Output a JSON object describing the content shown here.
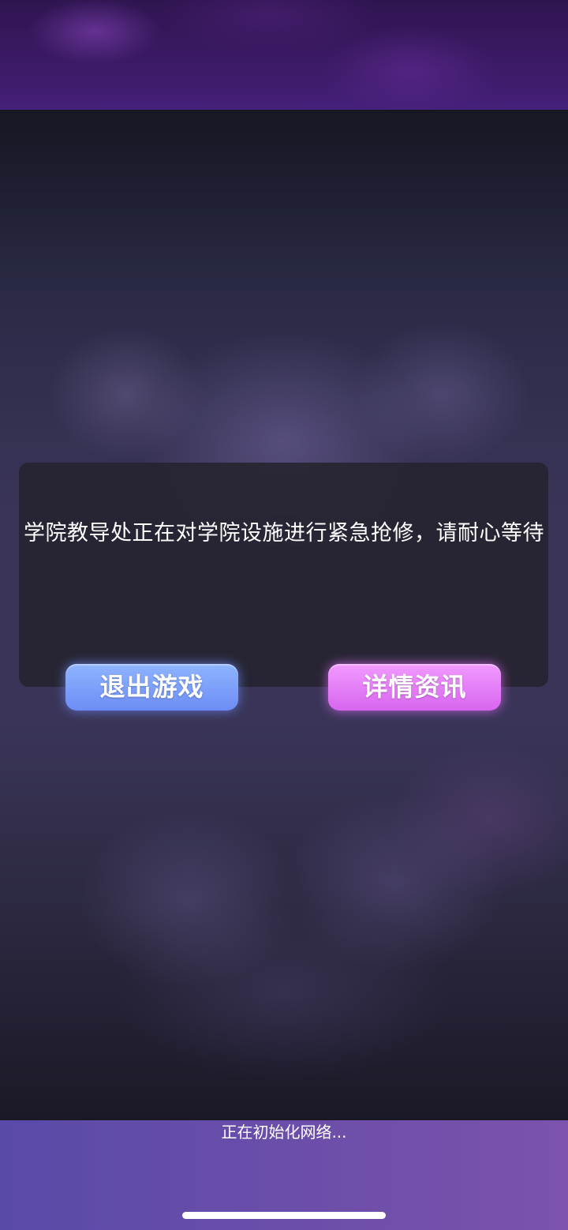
{
  "dialog": {
    "message": "学院教导处正在对学院设施进行紧急抢修，请耐心等待",
    "buttons": {
      "exit_label": "退出游戏",
      "details_label": "详情资讯"
    }
  },
  "status": {
    "loading_text": "正在初始化网络..."
  },
  "colors": {
    "exit_button": "#7a9cf9",
    "details_button": "#e27ff6",
    "bottom_bar": "#6a4eaa"
  }
}
